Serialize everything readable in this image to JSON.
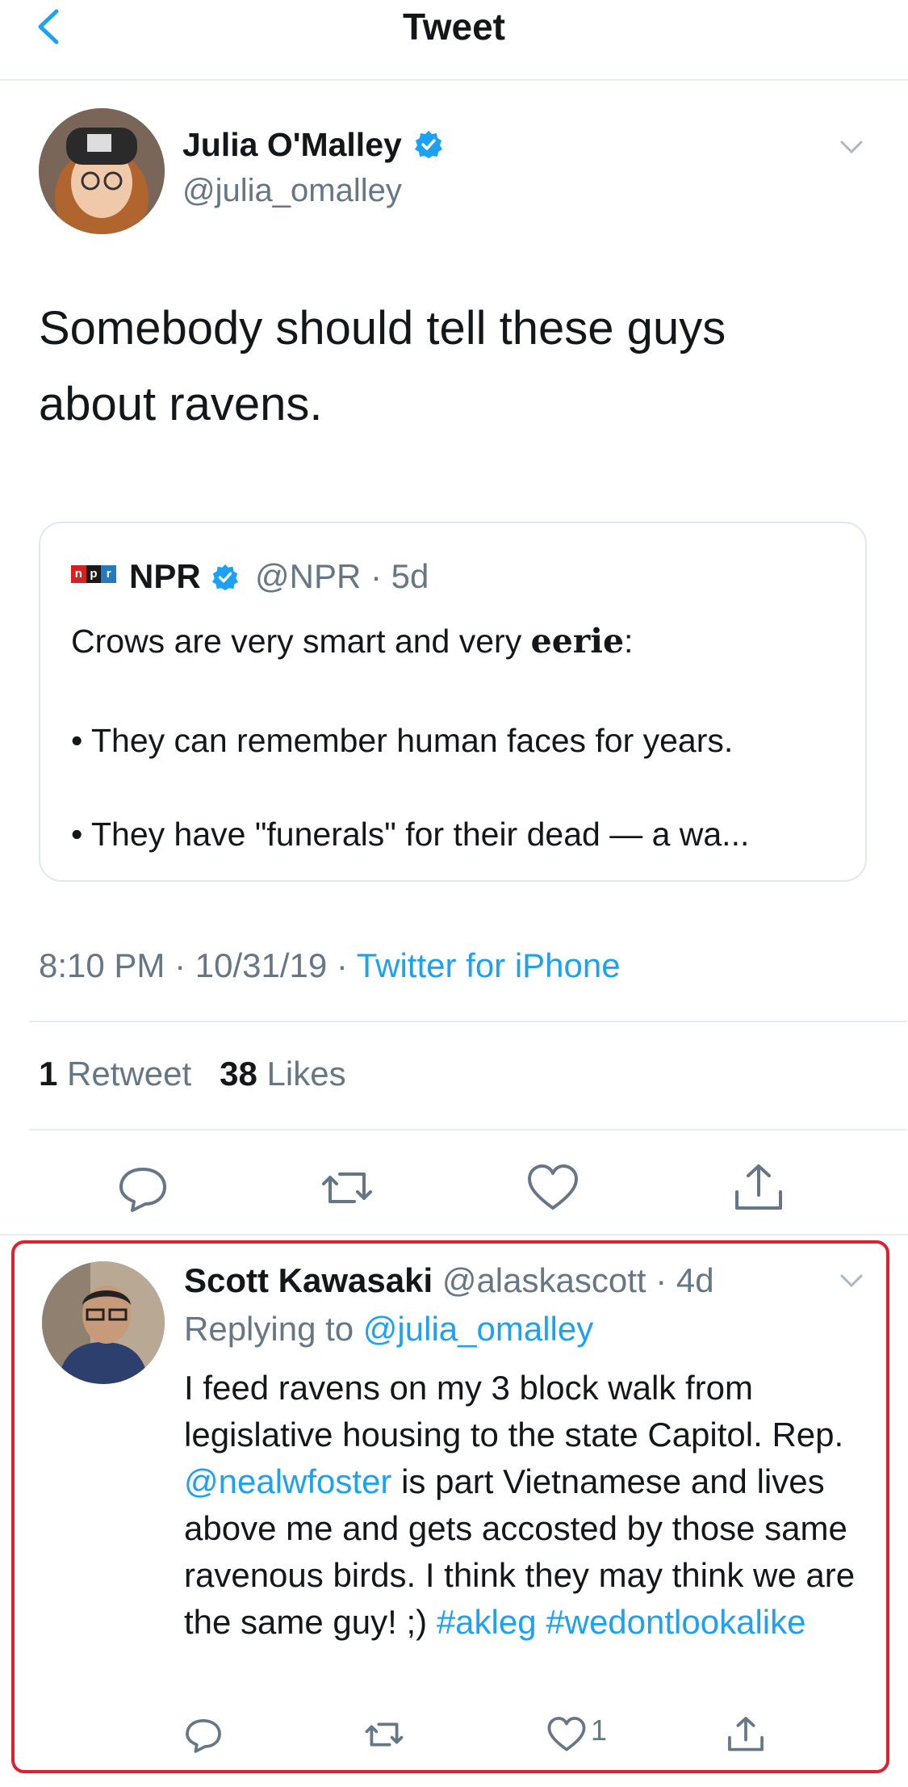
{
  "header": {
    "title": "Tweet"
  },
  "tweet": {
    "name": "Julia O'Malley",
    "handle": "@julia_omalley",
    "text": "Somebody should tell these guys about ravens.",
    "quote": {
      "name": "NPR",
      "handle_time": "@NPR · 5d",
      "line1_a": "Crows are very smart and very ",
      "line1_b": "eerie",
      "line1_c": ":",
      "line2": "• They can remember human faces for years.",
      "line3": "• They have \"funerals\" for their dead — a wa...",
      "logo_letters": [
        "n",
        "p",
        "r"
      ]
    },
    "time": "8:10 PM · 10/31/19 · ",
    "source": "Twitter for iPhone",
    "retweets": "1",
    "retweets_label": "Retweet",
    "likes": "38",
    "likes_label": "Likes"
  },
  "reply": {
    "name": "Scott Kawasaki",
    "handle_time": "@alaskascott · 4d",
    "replying_prefix": "Replying to ",
    "replying_to": "@julia_omalley",
    "text_1": "I feed ravens on my 3 block walk from legislative housing to the state Capitol. Rep. ",
    "mention": "@nealwfoster",
    "text_2": " is part Vietnamese and lives above me and gets accosted by those same ravenous birds. I think they may think we are the same guy! ;) ",
    "tag1": "#akleg",
    "tag2": "#wedontlookalike",
    "like_count": "1"
  },
  "icons": [
    "back-chevron-icon",
    "chevron-down-icon",
    "verified-badge-icon",
    "reply-icon",
    "retweet-icon",
    "like-icon",
    "share-icon"
  ],
  "colors": {
    "accent": "#1da1f2",
    "secondary_text": "#657786",
    "highlight_border": "#e0202e",
    "npr_red": "#d62021",
    "npr_black": "#1a1a1a",
    "npr_blue": "#237bbd"
  }
}
